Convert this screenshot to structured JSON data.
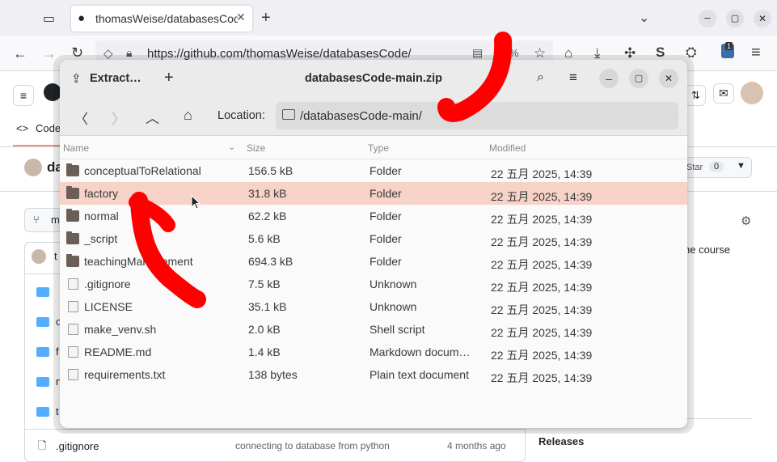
{
  "browser": {
    "tab_title": "thomasWeise/databasesCode",
    "url": "https://github.com/thomasWeise/databasesCode/",
    "new_tab": "+",
    "menu": "≡",
    "zoom_hint": "%",
    "badge": "1"
  },
  "github": {
    "tab_code": "Code",
    "repo_owner_short": "da",
    "star_label": "Star",
    "star_count": "0",
    "branch_short": "m",
    "about_snippet": "he course",
    "commit_author_short": "t",
    "sidebar_letters": [
      "c",
      "f",
      "n",
      "t"
    ],
    "bottom_file": ".gitignore",
    "bottom_commit": "connecting to database from python",
    "bottom_age": "4 months ago",
    "releases": "Releases"
  },
  "dialog": {
    "app_name": "Extract…",
    "add": "+",
    "title": "databasesCode-main.zip",
    "location_label": "Location:",
    "location_value": "/databasesCode-main/",
    "columns": {
      "name": "Name",
      "size": "Size",
      "type": "Type",
      "modified": "Modified"
    },
    "rows": [
      {
        "name": "conceptualToRelational",
        "size": "156.5 kB",
        "type": "Folder",
        "modified": "22 五月 2025, 14:39",
        "kind": "folder"
      },
      {
        "name": "factory",
        "size": "31.8 kB",
        "type": "Folder",
        "modified": "22 五月 2025, 14:39",
        "kind": "folder",
        "selected": true
      },
      {
        "name": "normal",
        "size": "62.2 kB",
        "type": "Folder",
        "modified": "22 五月 2025, 14:39",
        "kind": "folder"
      },
      {
        "name": "_script",
        "size": "5.6 kB",
        "type": "Folder",
        "modified": "22 五月 2025, 14:39",
        "kind": "folder"
      },
      {
        "name": "teachingManagement",
        "size": "694.3 kB",
        "type": "Folder",
        "modified": "22 五月 2025, 14:39",
        "kind": "folder"
      },
      {
        "name": ".gitignore",
        "size": "7.5 kB",
        "type": "Unknown",
        "modified": "22 五月 2025, 14:39",
        "kind": "file"
      },
      {
        "name": "LICENSE",
        "size": "35.1 kB",
        "type": "Unknown",
        "modified": "22 五月 2025, 14:39",
        "kind": "file"
      },
      {
        "name": "make_venv.sh",
        "size": "2.0 kB",
        "type": "Shell script",
        "modified": "22 五月 2025, 14:39",
        "kind": "file"
      },
      {
        "name": "README.md",
        "size": "1.4 kB",
        "type": "Markdown docum…",
        "modified": "22 五月 2025, 14:39",
        "kind": "file"
      },
      {
        "name": "requirements.txt",
        "size": "138 bytes",
        "type": "Plain text document",
        "modified": "22 五月 2025, 14:39",
        "kind": "file"
      }
    ]
  },
  "colors": {
    "selection": "#f6d2c7",
    "annotation": "#ff0000",
    "folder_dark": "#6b5d58",
    "github_folder": "#54aeff"
  }
}
